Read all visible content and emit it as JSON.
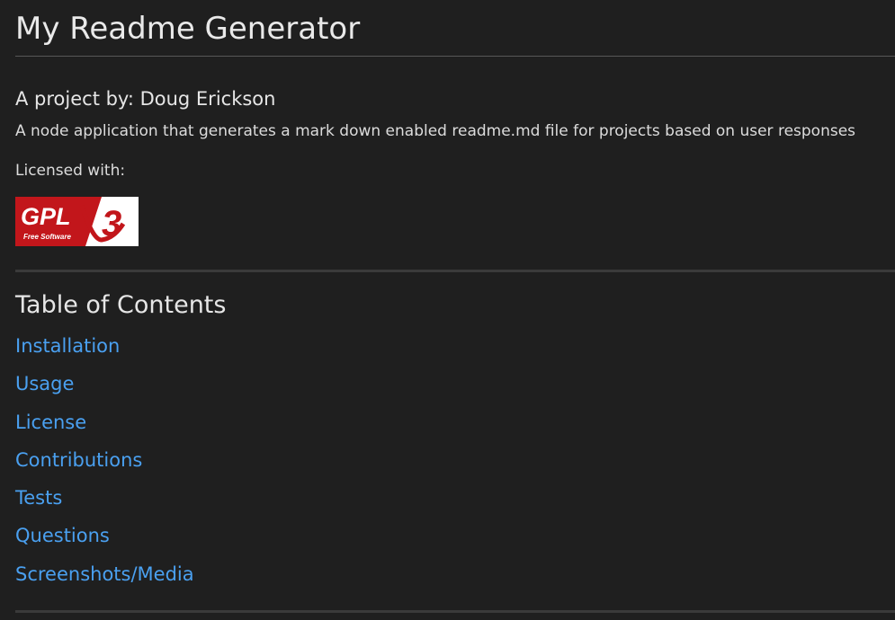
{
  "readme": {
    "title": "My Readme Generator",
    "author_line": "A project by: Doug Erickson",
    "description": "A node application that generates a mark down enabled readme.md file for projects based on user responses",
    "licensed_label": "Licensed with:",
    "license_badge": {
      "main_text": "GPL",
      "sub_text": "Free Software",
      "version": "3",
      "bg_color": "#c2161b",
      "fg_color": "#ffffff"
    }
  },
  "toc": {
    "heading": "Table of Contents",
    "items": [
      {
        "label": "Installation"
      },
      {
        "label": "Usage"
      },
      {
        "label": "License"
      },
      {
        "label": "Contributions"
      },
      {
        "label": "Tests"
      },
      {
        "label": "Questions"
      },
      {
        "label": "Screenshots/Media"
      }
    ]
  },
  "colors": {
    "background": "#1f1f1f",
    "link": "#4aa0f0",
    "text": "#e8e8e8"
  }
}
